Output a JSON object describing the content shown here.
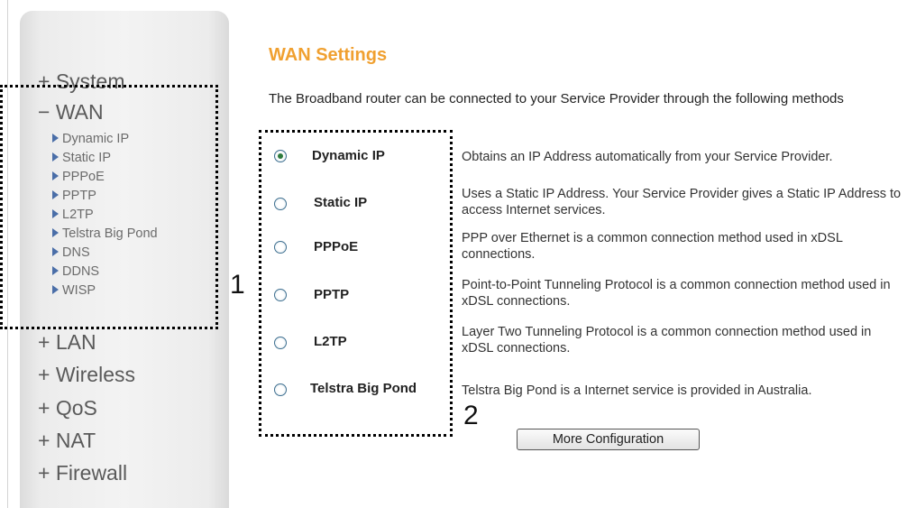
{
  "sidebar": {
    "items": [
      {
        "prefix": "+",
        "label": "System"
      },
      {
        "prefix": "−",
        "label": "WAN"
      },
      {
        "prefix": "+",
        "label": "LAN"
      },
      {
        "prefix": "+",
        "label": "Wireless"
      },
      {
        "prefix": "+",
        "label": "QoS"
      },
      {
        "prefix": "+",
        "label": "NAT"
      },
      {
        "prefix": "+",
        "label": "Firewall"
      }
    ],
    "wan_submenu": [
      "Dynamic IP",
      "Static IP",
      "PPPoE",
      "PPTP",
      "L2TP",
      "Telstra Big Pond",
      "DNS",
      "DDNS",
      "WISP"
    ]
  },
  "callouts": {
    "one": "1",
    "two": "2"
  },
  "main": {
    "title": "WAN Settings",
    "intro": "The Broadband router can be connected to your Service Provider through the following methods",
    "methods": [
      {
        "label": "Dynamic IP",
        "description": "Obtains an IP Address automatically from your Service Provider.",
        "selected": true
      },
      {
        "label": "Static IP",
        "description": "Uses a Static IP Address. Your Service Provider gives a Static IP Address to access Internet services.",
        "selected": false
      },
      {
        "label": "PPPoE",
        "description": "PPP over Ethernet is a common connection method used in xDSL connections.",
        "selected": false
      },
      {
        "label": "PPTP",
        "description": "Point-to-Point Tunneling Protocol is a common connection method used in xDSL connections.",
        "selected": false
      },
      {
        "label": "L2TP",
        "description": "Layer Two Tunneling Protocol is a common connection method used in xDSL connections.",
        "selected": false
      },
      {
        "label": "Telstra Big Pond",
        "description": "Telstra Big Pond is a Internet service is provided in Australia.",
        "selected": false
      }
    ],
    "button_label": "More Configuration"
  },
  "colors": {
    "title": "#f0a030",
    "submenu_arrow": "#4a6ea8",
    "radio_border": "#3c6e8f"
  },
  "icons": {
    "submenu": "triangle-right-icon",
    "expand": "plus-icon",
    "collapse": "minus-icon"
  }
}
